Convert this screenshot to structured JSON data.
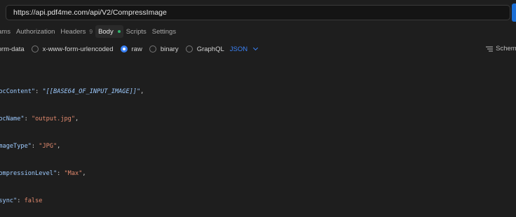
{
  "url_bar": {
    "value": "https://api.pdf4me.com/api/V2/CompressImage"
  },
  "tabs": [
    {
      "label": "ams",
      "active": false
    },
    {
      "label": "Authorization",
      "active": false
    },
    {
      "label": "Headers",
      "count": "9",
      "active": false
    },
    {
      "label": "Body",
      "active": true
    },
    {
      "label": "Scripts",
      "active": false
    },
    {
      "label": "Settings",
      "active": false
    }
  ],
  "body_types": [
    {
      "label": "form-data",
      "checked": false
    },
    {
      "label": "x-www-form-urlencoded",
      "checked": false
    },
    {
      "label": "raw",
      "checked": true
    },
    {
      "label": "binary",
      "checked": false
    },
    {
      "label": "GraphQL",
      "checked": false
    }
  ],
  "raw_format": "JSON",
  "schema_label": "Schema",
  "code": {
    "line1_key": "\"docContent\"",
    "line1_value": "\"[[BASE64_OF_INPUT_IMAGE]]\"",
    "line2_key": "\"docName\"",
    "line2_value": "\"output.jpg\"",
    "line3_key": "\"imageType\"",
    "line3_value": "\"JPG\"",
    "line4_key": "\"compressionLevel\"",
    "line4_value": "\"Max\"",
    "line5_key": "\"async\"",
    "line5_value": "false"
  },
  "colors": {
    "accent": "#3b82f6",
    "status_dot": "#2fb66e",
    "string_value": "#e38a6e",
    "json_key": "#9ecbff"
  }
}
